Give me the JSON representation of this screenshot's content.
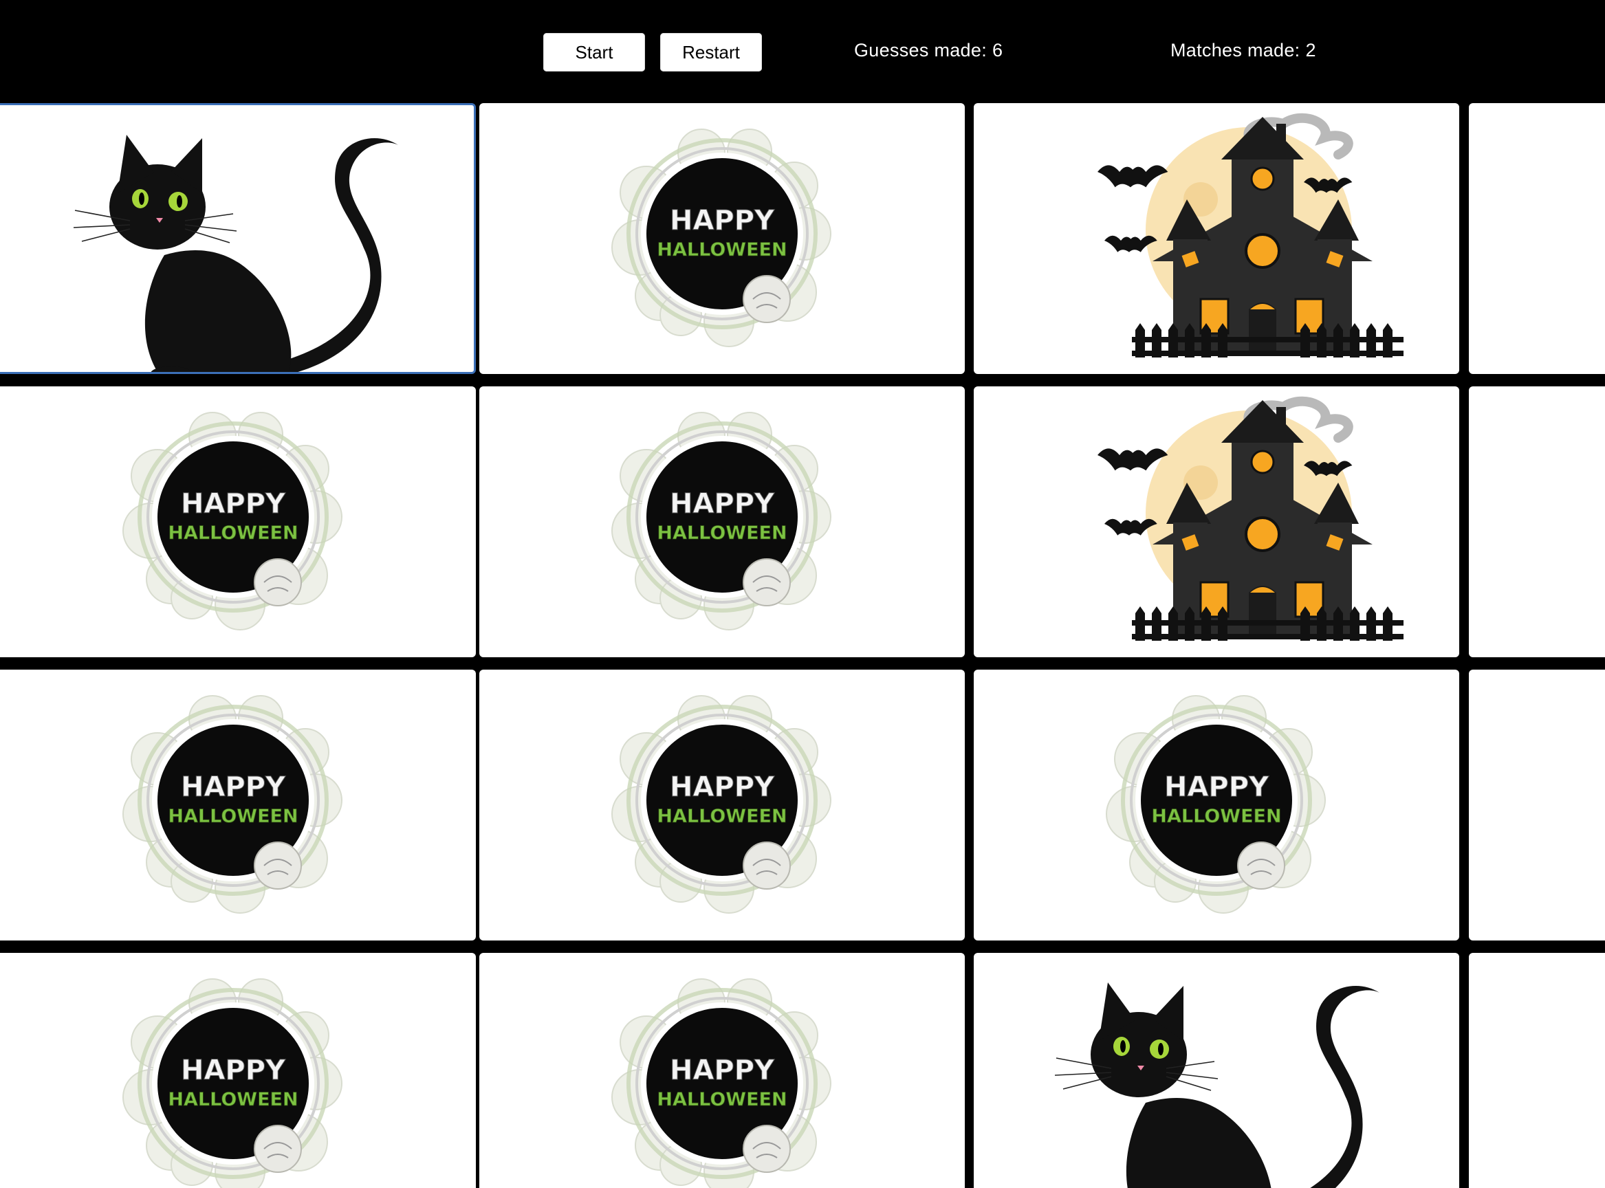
{
  "controls": {
    "start_label": "Start",
    "restart_label": "Restart"
  },
  "stats": {
    "guesses_label": "Guesses made:",
    "guesses_value": "6",
    "matches_label": "Matches made:",
    "matches_value": "2"
  },
  "card_back": {
    "line1": "HAPPY",
    "line2": "HALLOWEEN"
  },
  "colors": {
    "background": "#000000",
    "card_face": "#ffffff",
    "selected_border": "#3b6fb7",
    "halloween_green": "#7cc242"
  },
  "board": {
    "rows": [
      [
        "black-cat",
        "happy-halloween",
        "haunted-house",
        "hidden"
      ],
      [
        "happy-halloween",
        "happy-halloween",
        "haunted-house",
        "hidden"
      ],
      [
        "happy-halloween",
        "happy-halloween",
        "happy-halloween",
        "hidden"
      ],
      [
        "happy-halloween",
        "happy-halloween",
        "black-cat",
        "hidden"
      ]
    ],
    "selected_card": "r1c1"
  }
}
